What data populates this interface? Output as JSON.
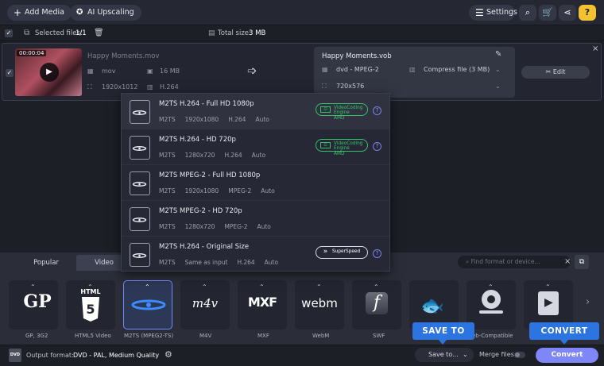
{
  "toolbar": {
    "add_media": "Add Media",
    "ai_upscaling": "AI Upscaling",
    "settings": "Settings"
  },
  "selection_bar": {
    "selected_label": "Selected files:",
    "selected_value": "1/1",
    "total_label": "Total size:",
    "total_value": "3 MB"
  },
  "source_file": {
    "duration": "00:00:04",
    "name": "Happy Moments.mov",
    "container": "mov",
    "size": "16 MB",
    "resolution": "1920x1012",
    "codec": "H.264"
  },
  "output_file": {
    "name": "Happy Moments.vob",
    "format": "dvd - MPEG-2",
    "compress": "Compress file (3 MB)",
    "resolution": "720x576",
    "edit": "Edit"
  },
  "presets": [
    {
      "title": "M2TS H.264 - Full HD 1080p",
      "container": "M2TS",
      "resolution": "1920x1080",
      "codec": "H.264",
      "bitrate": "Auto",
      "badge": "VideoCoding Engine"
    },
    {
      "title": "M2TS H.264 - HD 720p",
      "container": "M2TS",
      "resolution": "1280x720",
      "codec": "H.264",
      "bitrate": "Auto",
      "badge": "VideoCoding Engine"
    },
    {
      "title": "M2TS MPEG-2 - Full HD 1080p",
      "container": "M2TS",
      "resolution": "1920x1080",
      "codec": "MPEG-2",
      "bitrate": "Auto"
    },
    {
      "title": "M2TS MPEG-2 - HD 720p",
      "container": "M2TS",
      "resolution": "1280x720",
      "codec": "MPEG-2",
      "bitrate": "Auto"
    },
    {
      "title": "M2TS H.264 - Original Size",
      "container": "M2TS",
      "resolution": "Same as input",
      "codec": "H.264",
      "bitrate": "Auto",
      "badge": "SuperSpeed"
    }
  ],
  "badge_brand": "AMD",
  "tabs": {
    "popular": "Popular",
    "video": "Video"
  },
  "search_placeholder": "Find format or device...",
  "formats": [
    {
      "label": "GP",
      "caption": "GP, 3G2"
    },
    {
      "label": "HTML 5",
      "caption": "HTML5 Video"
    },
    {
      "label": "M2TS (MPEG2-TS)",
      "caption": "M2TS (MPEG2-TS)"
    },
    {
      "label": "m4v",
      "caption": "M4V"
    },
    {
      "label": "MXF",
      "caption": "MXF"
    },
    {
      "label": "webm",
      "caption": "WebM"
    },
    {
      "label": "f",
      "caption": "SWF"
    },
    {
      "label": "",
      "caption": ""
    },
    {
      "label": "",
      "caption": "eb-Compatible"
    },
    {
      "label": "",
      "caption": ""
    }
  ],
  "footer": {
    "output_label": "Output format:",
    "output_value": "DVD - PAL, Medium Quality",
    "save_to": "Save to...",
    "merge_files": "Merge files:",
    "convert": "Convert",
    "callout_save": "SAVE TO",
    "callout_convert": "CONVERT"
  },
  "colors": {
    "accent": "#2c74e0",
    "convert": "#7f86f7",
    "engine_green": "#35c06a"
  }
}
